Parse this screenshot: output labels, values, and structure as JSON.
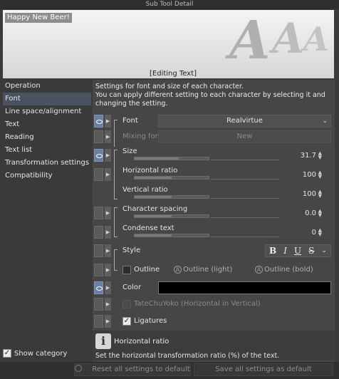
{
  "window": {
    "title": "Sub Tool Detail"
  },
  "preview": {
    "sample_text": "Happy New Beer!",
    "glyph": "A",
    "status": "[Editing Text]"
  },
  "sidebar": {
    "items": [
      {
        "label": "Operation"
      },
      {
        "label": "Font"
      },
      {
        "label": "Line space/alignment"
      },
      {
        "label": "Text"
      },
      {
        "label": "Reading"
      },
      {
        "label": "Text list"
      },
      {
        "label": "Transformation settings"
      },
      {
        "label": "Compatibility"
      }
    ],
    "active_index": 1,
    "show_category": {
      "label": "Show category",
      "checked": true
    }
  },
  "main": {
    "description": [
      "Settings for font and size of each character.",
      "You can apply different setting to each character by selecting it and",
      "changing the setting."
    ],
    "font": {
      "label": "Font",
      "value": "Realvirtue"
    },
    "mixing_font": {
      "label": "Mixing font",
      "value": "New"
    },
    "size": {
      "label": "Size",
      "value": "31.7",
      "level": 0.6
    },
    "horizontal_ratio": {
      "label": "Horizontal ratio",
      "value": "100",
      "level": 0.5
    },
    "vertical_ratio": {
      "label": "Vertical ratio",
      "value": "100",
      "level": 0.5
    },
    "character_spacing": {
      "label": "Character spacing",
      "value": "0.0",
      "level": 0.5
    },
    "condense_text": {
      "label": "Condense text",
      "value": "0",
      "level": 0.5
    },
    "style": {
      "label": "Style",
      "buttons": [
        "B",
        "I",
        "U",
        "S"
      ]
    },
    "outline": {
      "label": "Outline",
      "light": "Outline (light)",
      "bold": "Outline (bold)",
      "icon_glyph": "A"
    },
    "color": {
      "label": "Color",
      "value": "#000000"
    },
    "tatechuyoko": {
      "label": "TateChuYoko (Horizontal in Vertical)"
    },
    "ligatures": {
      "label": "Ligatures",
      "checked": true
    },
    "info": {
      "icon_glyph": "i",
      "title": "Horizontal ratio",
      "text": "Set the horizontal transformation ratio (%) of the text."
    }
  },
  "footer": {
    "reset_label": "Reset all settings to default",
    "save_label": "Save all settings as default"
  },
  "colors": {
    "accent": "#6a7fa6",
    "selection": "#4a5160",
    "panel": "#464646",
    "background": "#3a3a3a"
  }
}
